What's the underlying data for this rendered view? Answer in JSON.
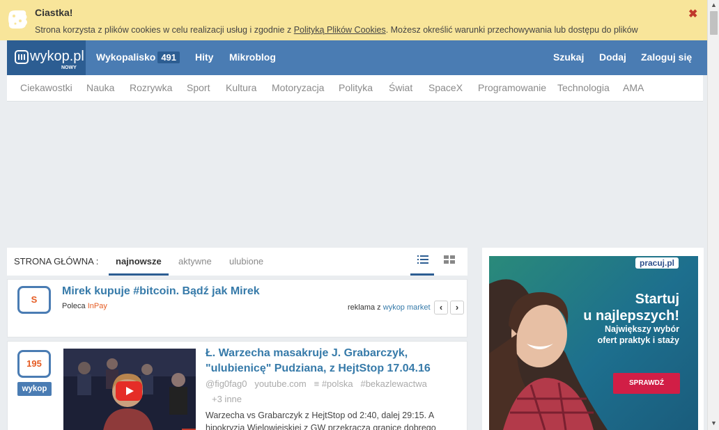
{
  "cookie": {
    "title": "Ciastka!",
    "text_before": "Strona korzysta z plików cookies w celu realizacji usług i zgodnie z ",
    "link": "Polityką Plików Cookies",
    "text_after": ". Możesz określić warunki przechowywania lub dostępu do plików",
    "close": "✖"
  },
  "header": {
    "logo": "wykop.pl",
    "logo_sub": "NOWY",
    "nav": [
      {
        "label": "Wykopalisko",
        "badge": "491"
      },
      {
        "label": "Hity"
      },
      {
        "label": "Mikroblog"
      }
    ],
    "right": [
      "Szukaj",
      "Dodaj",
      "Zaloguj się"
    ]
  },
  "categories": [
    "Ciekawostki",
    "Nauka",
    "Rozrywka",
    "Sport",
    "Kultura",
    "Motoryzacja",
    "Polityka",
    "Świat",
    "SpaceX",
    "Programowanie",
    "Technologia",
    "AMA"
  ],
  "tabs": {
    "label": "STRONA GŁÓWNA :",
    "items": [
      "najnowsze",
      "aktywne",
      "ulubione"
    ],
    "active": "najnowsze"
  },
  "promo": {
    "vote": "S",
    "title": "Mirek kupuje #bitcoin. Bądź jak Mirek",
    "poleca_label": "Poleca",
    "poleca_value": "InPay",
    "ad_label": "reklama z",
    "ad_link": "wykop market",
    "prev": "‹",
    "next": "›"
  },
  "entry": {
    "votes": "195",
    "vote_button": "wykop",
    "title": "Ł. Warzecha masakruje J. Grabarczyk, \"ulubienicę\" Pudziana, z HejtStop 17.04.16",
    "author": "@fig0fag0",
    "domain": "youtube.com",
    "tag1": "#polska",
    "tag2": "#bekazlewactwa",
    "more": "+3 inne",
    "description": "Warzecha vs Grabarczyk z HejtStop od 2:40, dalej 29:15. A hipokryzja Wielowiejskiej z GW przekracza granice dobrego"
  },
  "ad": {
    "brand": "pracuj.pl",
    "headline_1": "Startuj",
    "headline_2": "u najlepszych!",
    "sub_1": "Największy wybór",
    "sub_2": "ofert praktyk i staży",
    "cta": "SPRAWDŹ"
  }
}
